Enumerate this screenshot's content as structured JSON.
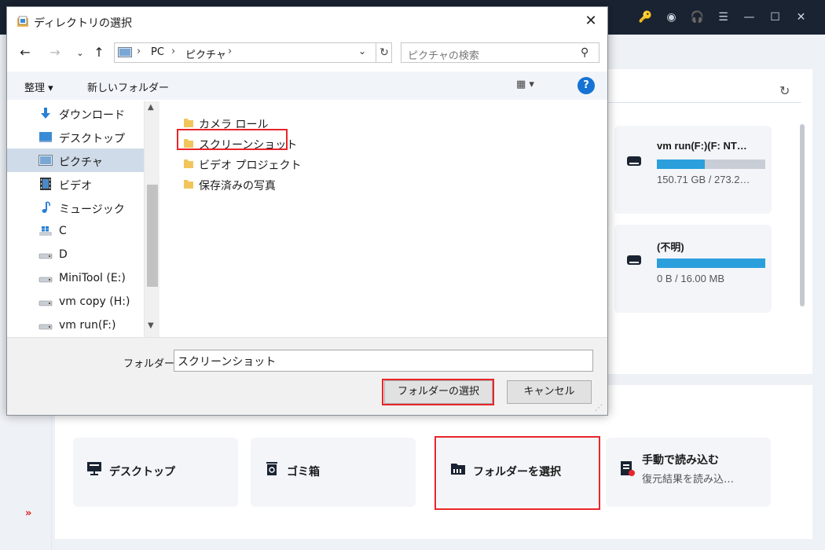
{
  "app": {
    "topbar_icons": [
      "key-icon",
      "disc-icon",
      "headset-icon",
      "menu-icon",
      "minimize-icon",
      "maximize-icon",
      "close-icon"
    ],
    "drives": [
      {
        "name": "vm run(F:)(F: NT…",
        "size": "150.71 GB / 273.2…",
        "used_fraction": 0.44
      },
      {
        "name": "(不明)",
        "size": "0 B / 16.00 MB",
        "used_fraction": 1.0
      }
    ],
    "locations": {
      "desktop": "デスクトップ",
      "trash": "ゴミ箱",
      "select_folder": "フォルダーを選択",
      "manual_load_title": "手動で読み込む",
      "manual_load_sub": "復元結果を読み込…"
    },
    "colors": {
      "accent_blue": "#2b9fdc",
      "highlight_red": "#e8262a",
      "topbar": "#1a2332"
    }
  },
  "dialog": {
    "title": "ディレクトリの選択",
    "breadcrumb": [
      "PC",
      "ピクチャ"
    ],
    "search_placeholder": "ピクチャの検索",
    "toolbar": {
      "organize": "整理 ▾",
      "new_folder": "新しいフォルダー"
    },
    "nav_items": [
      {
        "label": "ダウンロード",
        "icon": "download-icon"
      },
      {
        "label": "デスクトップ",
        "icon": "desktop-icon"
      },
      {
        "label": "ピクチャ",
        "icon": "pictures-icon",
        "selected": true
      },
      {
        "label": "ビデオ",
        "icon": "video-icon"
      },
      {
        "label": "ミュージック",
        "icon": "music-icon"
      },
      {
        "label": "C",
        "icon": "windows-drive-icon"
      },
      {
        "label": "D",
        "icon": "drive-icon"
      },
      {
        "label": "MiniTool (E:)",
        "icon": "drive-icon"
      },
      {
        "label": "vm copy (H:)",
        "icon": "drive-icon"
      },
      {
        "label": "vm run(F:)",
        "icon": "drive-icon"
      }
    ],
    "folders": [
      "カメラ ロール",
      "スクリーンショット",
      "ビデオ プロジェクト",
      "保存済みの写真"
    ],
    "selected_folder": "スクリーンショット",
    "footer": {
      "folder_label": "フォルダー:",
      "folder_value": "スクリーンショット",
      "select_button": "フォルダーの選択",
      "cancel_button": "キャンセル"
    }
  }
}
